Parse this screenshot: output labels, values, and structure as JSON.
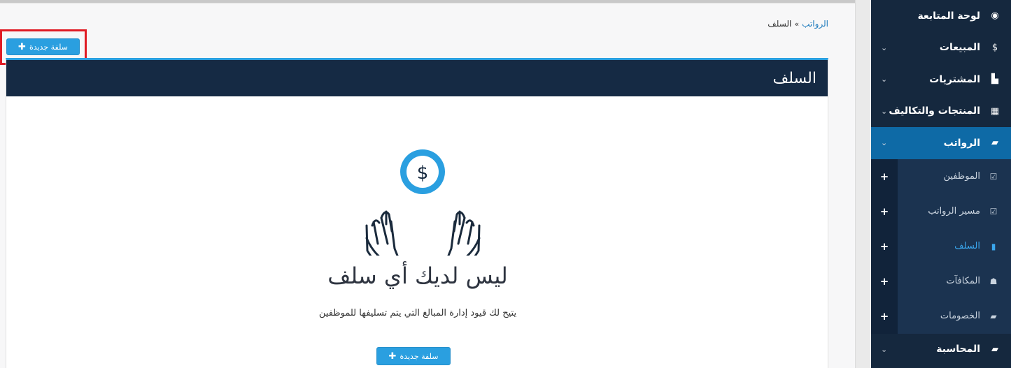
{
  "breadcrumb": {
    "parent": "الرواتب",
    "separator": "»",
    "current": "السلف"
  },
  "actions": {
    "new_advance_label": "سلفة جديدة"
  },
  "panel": {
    "title": "السلف"
  },
  "empty_state": {
    "title": "ليس لديك أي سلف",
    "subtitle": "يتيح لك قيود إدارة المبالغ التي يتم تسليفها للموظفين",
    "button_label": "سلفة جديدة"
  },
  "sidebar": {
    "items": [
      {
        "label": "لوحة المتابعة",
        "icon": "dashboard-icon",
        "has_chevron": false
      },
      {
        "label": "المبيعات",
        "icon": "dollar-icon",
        "has_chevron": true
      },
      {
        "label": "المشتريات",
        "icon": "cart-icon",
        "has_chevron": true
      },
      {
        "label": "المنتجات والتكاليف",
        "icon": "grid-icon",
        "has_chevron": true
      },
      {
        "label": "الرواتب",
        "icon": "folder-open-icon",
        "has_chevron": true,
        "active": true
      }
    ],
    "payroll_sub": [
      {
        "label": "الموظفين",
        "icon": "calendar-check-icon"
      },
      {
        "label": "مسير الرواتب",
        "icon": "calendar-check-icon"
      },
      {
        "label": "السلف",
        "icon": "book-icon",
        "active": true
      },
      {
        "label": "المكافآت",
        "icon": "users-icon"
      },
      {
        "label": "الخصومات",
        "icon": "folder-open-icon"
      }
    ],
    "after": [
      {
        "label": "المحاسبة",
        "icon": "folder-open-icon",
        "has_chevron": true
      }
    ]
  },
  "colors": {
    "accent": "#2a9fe0",
    "sidebar_bg": "#15283e",
    "active_bg": "#0e6aa6",
    "panel_header": "#152a44",
    "highlight": "#e01b24"
  }
}
